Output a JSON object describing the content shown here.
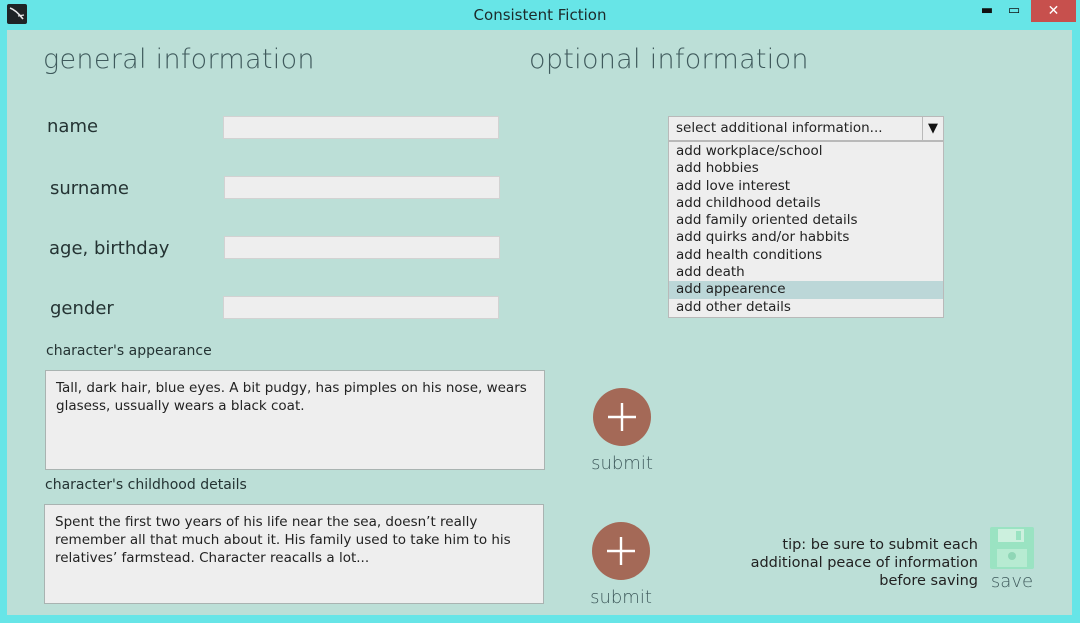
{
  "window": {
    "title": "Consistent Fiction",
    "minimize": "▬",
    "maximize": "▭",
    "close": "✕"
  },
  "general": {
    "heading": "general information",
    "name_label": "name",
    "surname_label": "surname",
    "age_label": "age, birthday",
    "gender_label": "gender",
    "appearance_label": "character's appearance",
    "appearance_text": "Tall, dark hair, blue eyes. A bit pudgy, has pimples on his nose, wears glasess, ussually wears a black coat.",
    "childhood_label": "character's childhood details",
    "childhood_text": "Spent the first two years of his life near the sea, doesn’t really remember all that much about it. His family used to take him to his relatives’ farmstead. Character reacalls a lot..."
  },
  "optional": {
    "heading": "optional information",
    "select_placeholder": "select additional information...",
    "options": [
      "add workplace/school",
      "add hobbies",
      "add love interest",
      "add childhood details",
      "add family oriented details",
      "add quirks and/or habbits",
      "add health conditions",
      "add death",
      "add appearence",
      "add other details"
    ],
    "selected_index": 8
  },
  "submit_label": "submit",
  "tip_text": "tip: be sure to submit each additional peace of information before saving",
  "save_label": "save",
  "icons": {
    "app": "quill-icon",
    "submit": "plus-icon",
    "save": "floppy-disk-icon",
    "dropdown": "triangle-down-icon"
  },
  "colors": {
    "titlebar": "#67e5e7",
    "panel": "#bcdfd7",
    "submit_button": "#a46957",
    "close_button": "#c7504d",
    "save_icon": "#9ae3c2",
    "heading_text": "#3f5a5c"
  }
}
